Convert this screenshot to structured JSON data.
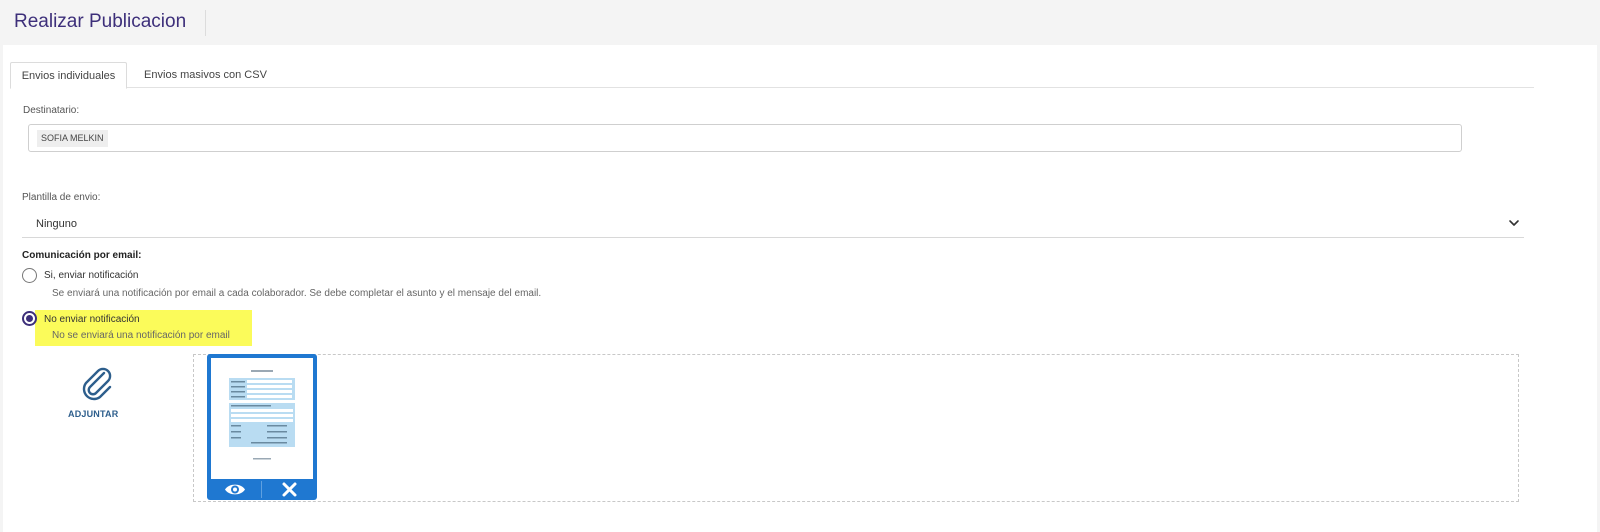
{
  "header": {
    "title": "Realizar Publicacion"
  },
  "tabs": [
    {
      "label": "Envios individuales",
      "active": true
    },
    {
      "label": "Envios masivos con CSV",
      "active": false
    }
  ],
  "recipient": {
    "label": "Destinatario:",
    "chips": [
      "SOFIA MELKIN"
    ]
  },
  "template": {
    "label": "Plantilla de envio:",
    "selected": "Ninguno"
  },
  "email": {
    "title": "Comunicación por email:",
    "options": [
      {
        "label": "Si, enviar notificación",
        "description": "Se enviará una notificación por email a cada colaborador. Se debe completar el asunto y el mensaje del email.",
        "selected": false
      },
      {
        "label": "No enviar notificación",
        "description": "No se enviará una notificación por email",
        "selected": true
      }
    ]
  },
  "attach": {
    "label": "ADJUNTAR",
    "icon": "paperclip-icon"
  },
  "colors": {
    "accent": "#3d2f7a",
    "card": "#1f78d1",
    "highlight": "#fbfb5a",
    "attach": "#2d5e8c"
  }
}
